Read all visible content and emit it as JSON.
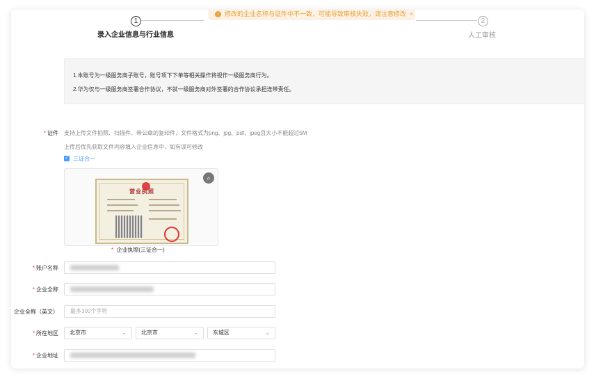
{
  "steps": [
    {
      "num": "1",
      "label": "录入企业信息与行业信息"
    },
    {
      "num": "2",
      "label": "人工审核"
    }
  ],
  "toast": {
    "icon": "warning-icon",
    "text": "修改的企业名称与证件中不一致，可能导致审核失败，请注意修改",
    "close": "×"
  },
  "notice": {
    "line1": "1.本账号为一级服务商子账号，账号项下下单等相关操作将视作一级服务商行为。",
    "line2": "2.华为仅与一级服务商签署合作协议，不就一级服务商对外签署的合作协议承担连带责任。"
  },
  "certificate": {
    "label": "证件",
    "hint1": "支持上传文件拍照、扫描件、带公章的复印件，文件格式为png、jpg、pdf、jpeg且大小不能超过5M",
    "hint2": "上传后优先获取文件内容填入企业信息中，如有误可修改",
    "checkbox_label": "三证合一",
    "checkbox_checked": true,
    "license_title": "营业执照",
    "caption": "企业执照(三证合一)"
  },
  "form": {
    "account_name_label": "账户名称",
    "company_name_label": "企业全称",
    "company_name_en_label": "企业全称（英文）",
    "company_name_en_placeholder": "最多300个字符",
    "region_label": "所在地区",
    "province": "北京市",
    "city": "北京市",
    "district": "东城区",
    "address_label": "企业地址"
  },
  "required_mark": "*"
}
